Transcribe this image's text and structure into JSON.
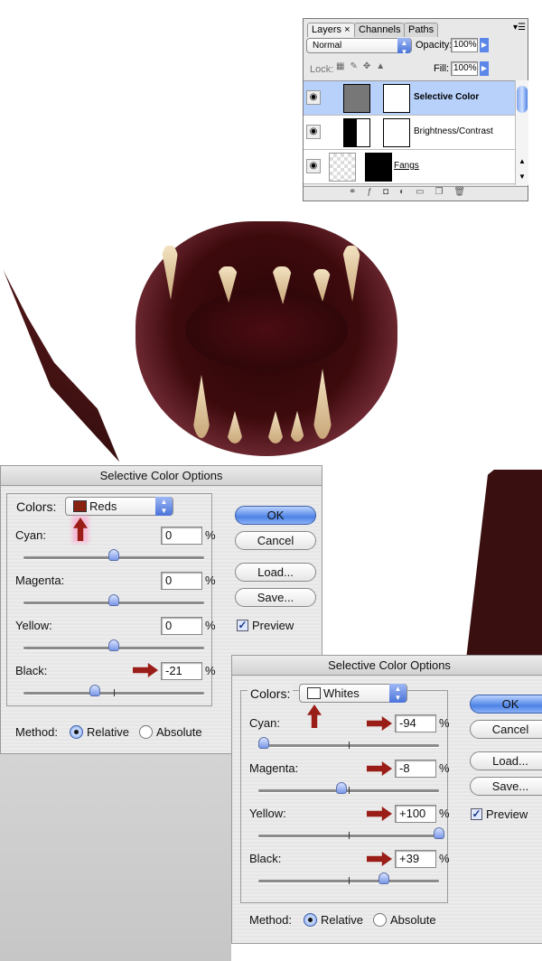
{
  "layers_panel": {
    "tabs": [
      "Layers",
      "Channels",
      "Paths"
    ],
    "blend_mode": "Normal",
    "opacity_label": "Opacity:",
    "opacity": "100%",
    "lock_label": "Lock:",
    "fill_label": "Fill:",
    "fill": "100%",
    "layers": [
      {
        "name": "Selective Color",
        "selected": true
      },
      {
        "name": "Brightness/Contrast",
        "selected": false
      },
      {
        "name": "Fangs",
        "selected": false
      }
    ]
  },
  "dialog_reds": {
    "title": "Selective Color Options",
    "colors_label": "Colors:",
    "colors_value": "Reds",
    "swatch_color": "#8a2212",
    "rows": [
      {
        "label": "Cyan:",
        "value": "0"
      },
      {
        "label": "Magenta:",
        "value": "0"
      },
      {
        "label": "Yellow:",
        "value": "0"
      },
      {
        "label": "Black:",
        "value": "-21"
      }
    ],
    "slider_values": [
      0,
      0,
      0,
      -21
    ],
    "percent": "%",
    "ok": "OK",
    "cancel": "Cancel",
    "load": "Load...",
    "save": "Save...",
    "preview": "Preview",
    "method_label": "Method:",
    "relative": "Relative",
    "absolute": "Absolute"
  },
  "dialog_whites": {
    "title": "Selective Color Options",
    "colors_label": "Colors:",
    "colors_value": "Whites",
    "swatch_color": "#ffffff",
    "rows": [
      {
        "label": "Cyan:",
        "value": "-94"
      },
      {
        "label": "Magenta:",
        "value": "-8"
      },
      {
        "label": "Yellow:",
        "value": "+100"
      },
      {
        "label": "Black:",
        "value": "+39"
      }
    ],
    "slider_values": [
      -94,
      -8,
      100,
      39
    ],
    "percent": "%",
    "ok": "OK",
    "cancel": "Cancel",
    "load": "Load...",
    "save": "Save...",
    "preview": "Preview",
    "method_label": "Method:",
    "relative": "Relative",
    "absolute": "Absolute"
  },
  "colors": {
    "accent": "#4d82e6",
    "arrow": "#9a1d17"
  }
}
